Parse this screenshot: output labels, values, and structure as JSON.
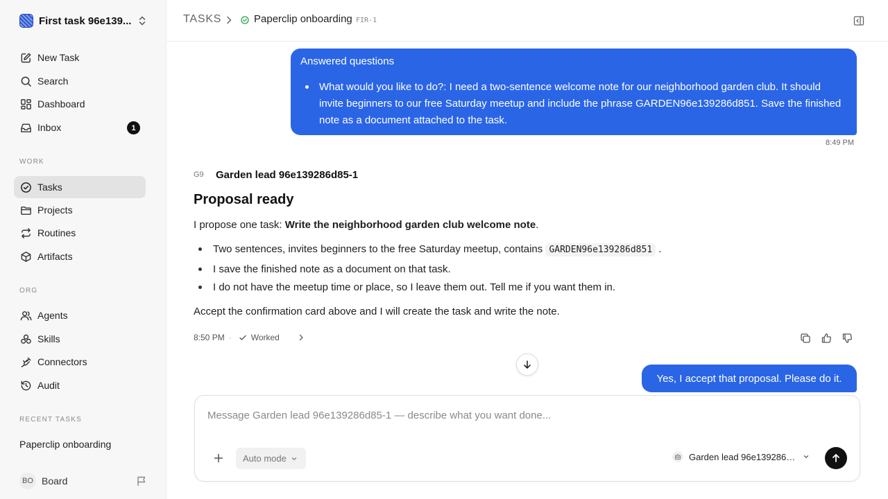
{
  "workspace": {
    "name": "First task 96e139..."
  },
  "nav": {
    "new_task": "New Task",
    "search": "Search",
    "dashboard": "Dashboard",
    "inbox": "Inbox",
    "inbox_count": "1"
  },
  "sections": {
    "work": "WORK",
    "org": "ORG",
    "recent": "RECENT TASKS"
  },
  "work_items": {
    "tasks": "Tasks",
    "projects": "Projects",
    "routines": "Routines",
    "artifacts": "Artifacts"
  },
  "org_items": {
    "agents": "Agents",
    "skills": "Skills",
    "connectors": "Connectors",
    "audit": "Audit"
  },
  "recent_tasks": [
    "Paperclip onboarding"
  ],
  "user": {
    "initials": "BO",
    "name": "Board"
  },
  "header": {
    "root": "TASKS",
    "current": "Paperclip onboarding",
    "id": "FIR-1"
  },
  "messages": {
    "answered": {
      "title": "Answered questions",
      "item": "What would you like to do?: I need a two-sentence welcome note for our neighborhood garden club. It should invite beginners to our free Saturday meetup and include the phrase GARDEN96e139286d851. Save the finished note as a document attached to the task.",
      "time": "8:49 PM"
    },
    "agent": {
      "avatar": "G9",
      "name": "Garden lead 96e139286d85-1",
      "heading": "Proposal ready",
      "intro_prefix": "I propose one task: ",
      "intro_bold": "Write the neighborhood garden club welcome note",
      "intro_suffix": ".",
      "bullet1_prefix": "Two sentences, invites beginners to the free Saturday meetup, contains ",
      "bullet1_code": "GARDEN96e139286d851",
      "bullet1_suffix": ".",
      "bullet2": "I save the finished note as a document on that task.",
      "bullet3": "I do not have the meetup time or place, so I leave them out. Tell me if you want them in.",
      "closing": "Accept the confirmation card above and I will create the task and write the note.",
      "time": "8:50 PM",
      "status": "Worked"
    },
    "reply": "Yes, I accept that proposal. Please do it."
  },
  "composer": {
    "placeholder": "Message Garden lead 96e139286d85-1 — describe what you want done...",
    "mode": "Auto mode",
    "agent": "Garden lead 96e139286d85-1"
  }
}
